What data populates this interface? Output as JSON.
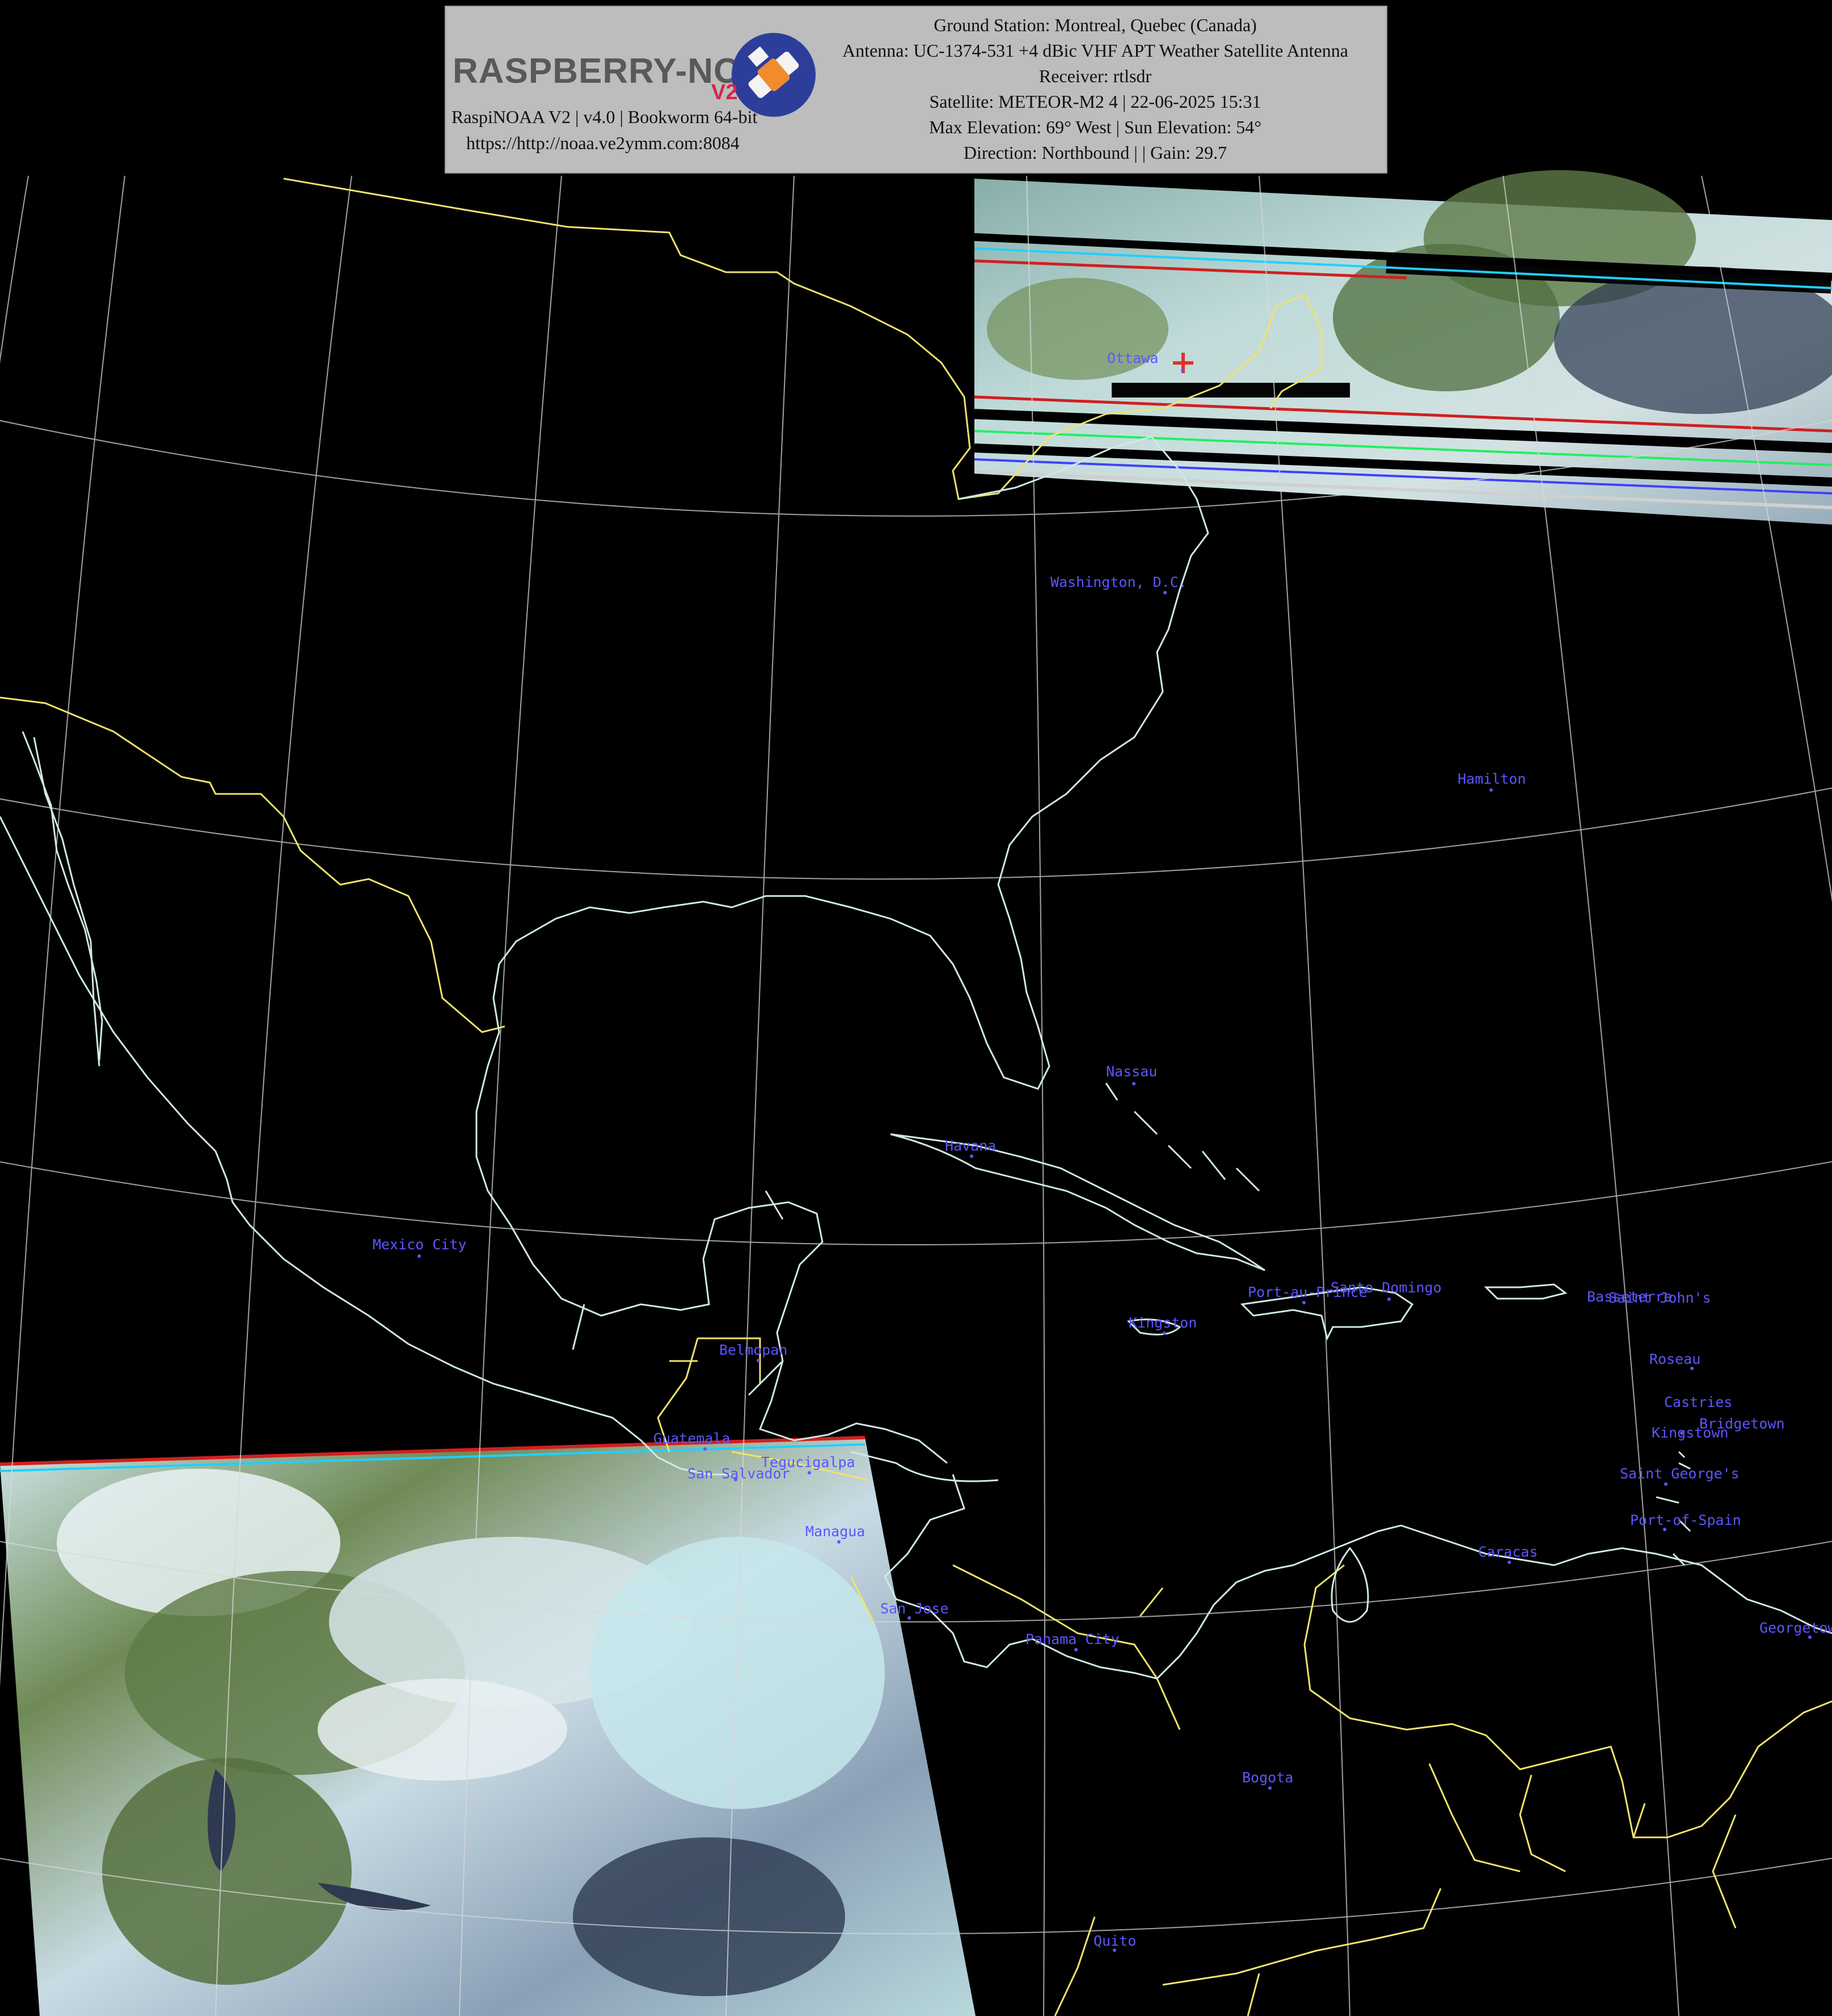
{
  "header": {
    "logo_text": "RASPBERRY-NOAA",
    "logo_badge": "V2",
    "software": "RaspiNOAA V2 | v4.0 | Bookworm 64-bit",
    "url": "https://http://noaa.ve2ymm.com:8084",
    "ground_station": "Ground Station: Montreal, Quebec (Canada)",
    "antenna": "Antenna: UC-1374-531 +4 dBic VHF APT Weather Satellite Antenna",
    "receiver": "Receiver: rtlsdr",
    "satellite": "Satellite: METEOR-M2 4 | 22-06-2025 15:31",
    "elevation": "Max Elevation: 69° West | Sun Elevation: 54°",
    "direction": "Direction: Northbound |  | Gain: 29.7"
  },
  "colors": {
    "background": "#000000",
    "coastline": "#cfe9e6",
    "border": "#f0e36a",
    "graticule": "#d8d8d8",
    "city_label": "#5d55ff",
    "ground_station_marker": "#e0312e",
    "info_box": "#bdbdbd"
  },
  "ground_station_marker": {
    "label": "Ottawa",
    "icon": "red-plus-marker"
  },
  "cities": [
    {
      "name": "Ottawa"
    },
    {
      "name": "Washington, D.C."
    },
    {
      "name": "Hamilton"
    },
    {
      "name": "Nassau"
    },
    {
      "name": "Havana"
    },
    {
      "name": "Mexico City"
    },
    {
      "name": "Kingston"
    },
    {
      "name": "Port-au-Prince"
    },
    {
      "name": "Santo Domingo"
    },
    {
      "name": "Basseterre"
    },
    {
      "name": "Saint John's"
    },
    {
      "name": "Roseau"
    },
    {
      "name": "Castries"
    },
    {
      "name": "Kingstown"
    },
    {
      "name": "Bridgetown"
    },
    {
      "name": "Saint George's"
    },
    {
      "name": "Port-of-Spain"
    },
    {
      "name": "Caracas"
    },
    {
      "name": "Georgetown"
    },
    {
      "name": "Belmopan"
    },
    {
      "name": "Guatemala"
    },
    {
      "name": "San Salvador"
    },
    {
      "name": "Tegucigalpa"
    },
    {
      "name": "Managua"
    },
    {
      "name": "San Jose"
    },
    {
      "name": "Panama City"
    },
    {
      "name": "Bogota"
    },
    {
      "name": "Quito"
    }
  ]
}
